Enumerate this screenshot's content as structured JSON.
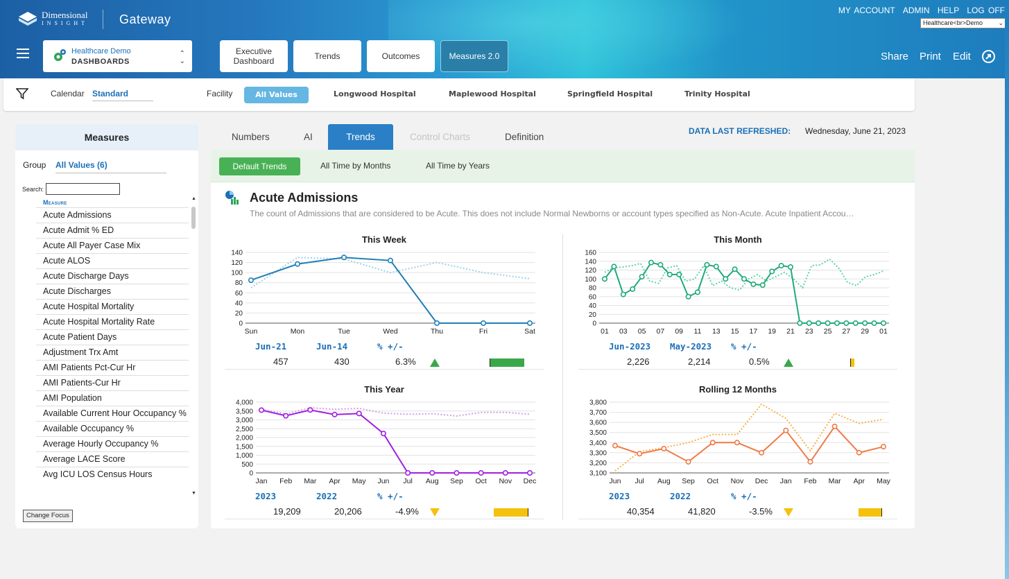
{
  "brand": {
    "name": "Dimensional",
    "sub": "INSIGHT",
    "product": "Gateway"
  },
  "toplinks": [
    "MY ACCOUNT",
    "ADMIN",
    "HELP",
    "LOG OFF"
  ],
  "demo_select": "Healthcare<br>Demo",
  "dashboard_select": {
    "line1": "Healthcare Demo",
    "line2": "DASHBOARDS"
  },
  "nav": [
    {
      "label": "Executive Dashboard"
    },
    {
      "label": "Trends"
    },
    {
      "label": "Outcomes"
    },
    {
      "label": "Measures 2.0"
    }
  ],
  "actions": {
    "share": "Share",
    "print": "Print",
    "edit": "Edit"
  },
  "filters": {
    "calendar_label": "Calendar",
    "calendar_value": "Standard",
    "facility_label": "Facility",
    "facilities": [
      "All Values",
      "Longwood Hospital",
      "Maplewood Hospital",
      "Springfield Hospital",
      "Trinity Hospital"
    ]
  },
  "sidebar": {
    "title": "Measures",
    "group_label": "Group",
    "group_value": "All Values (6)",
    "search_label": "Search:",
    "column_header": "Measure",
    "items": [
      "Acute Admissions",
      "Acute Admit % ED",
      "Acute All Payer Case Mix",
      "Acute ALOS",
      "Acute Discharge Days",
      "Acute Discharges",
      "Acute Hospital Mortality",
      "Acute Hospital Mortality Rate",
      "Acute Patient Days",
      "Adjustment Trx Amt",
      "AMI Patients Pct-Cur Hr",
      "AMI Patients-Cur Hr",
      "AMI Population",
      "Available Current Hour Occupancy %",
      "Available Occupancy %",
      "Average Hourly Occupancy %",
      "Average LACE Score",
      "Avg ICU LOS Census Hours"
    ],
    "change_focus": "Change Focus"
  },
  "tabs": [
    "Numbers",
    "AI",
    "Trends",
    "Control Charts",
    "Definition"
  ],
  "refreshed": {
    "label": "DATA LAST REFRESHED:",
    "value": "Wednesday, June 21, 2023"
  },
  "subtabs": [
    "Default Trends",
    "All Time by Months",
    "All Time by Years"
  ],
  "measure": {
    "title": "Acute Admissions",
    "description": "The count of Admissions that are considered to be Acute. This does not include Normal Newborns or account types specified as Non-Acute. Acute Inpatient Accou…"
  },
  "chart_data": [
    {
      "type": "line",
      "title": "This Week",
      "categories": [
        "Sun",
        "Mon",
        "Tue",
        "Wed",
        "Thu",
        "Fri",
        "Sat"
      ],
      "ylim": [
        0,
        140
      ],
      "yticks": [
        0,
        20,
        40,
        60,
        80,
        100,
        120,
        140
      ],
      "series": [
        {
          "values": [
            85,
            117,
            130,
            124,
            0,
            0,
            0
          ]
        },
        {
          "values": [
            70,
            130,
            127,
            100,
            120,
            100,
            88
          ]
        }
      ],
      "colors": {
        "main": "#1f7fb5",
        "prior": "#9fd0ee"
      },
      "stats": {
        "col1_header": "Jun-21",
        "col2_header": "Jun-14",
        "col3_header": "% +/-",
        "col1_value": "457",
        "col2_value": "430",
        "col3_value": "6.3%",
        "direction": "up",
        "bar_fraction": 0.9,
        "bar_color": "#3aa84a"
      }
    },
    {
      "type": "line",
      "title": "This Month",
      "categories": [
        "01",
        "03",
        "05",
        "07",
        "09",
        "11",
        "13",
        "15",
        "17",
        "19",
        "21",
        "23",
        "25",
        "27",
        "29",
        "01"
      ],
      "ylim": [
        0,
        160
      ],
      "yticks": [
        0,
        20,
        40,
        60,
        80,
        100,
        120,
        140,
        160
      ],
      "series": [
        {
          "values": [
            100,
            128,
            65,
            77,
            105,
            137,
            132,
            110,
            110,
            60,
            70,
            132,
            128,
            100,
            122,
            100,
            88,
            86,
            117,
            130,
            127,
            0,
            0,
            0,
            0,
            0,
            0,
            0,
            0,
            0,
            0
          ]
        },
        {
          "values": [
            115,
            125,
            127,
            130,
            135,
            95,
            90,
            125,
            130,
            95,
            100,
            130,
            85,
            95,
            80,
            75,
            100,
            110,
            95,
            105,
            115,
            100,
            80,
            130,
            132,
            145,
            125,
            92,
            85,
            105,
            110,
            118
          ]
        }
      ],
      "colors": {
        "main": "#1faa78",
        "prior": "#5dd3a6"
      },
      "stats": {
        "col1_header": "Jun-2023",
        "col2_header": "May-2023",
        "col3_header": "% +/-",
        "col1_value": "2,226",
        "col2_value": "2,214",
        "col3_value": "0.5%",
        "direction": "up",
        "bar_fraction": 0.1,
        "bar_color": "#f4c20d"
      }
    },
    {
      "type": "line",
      "title": "This Year",
      "categories": [
        "Jan",
        "Feb",
        "Mar",
        "Apr",
        "May",
        "Jun",
        "Jul",
        "Aug",
        "Sep",
        "Oct",
        "Nov",
        "Dec"
      ],
      "ylim": [
        0,
        4000
      ],
      "yticks": [
        0,
        500,
        1000,
        1500,
        2000,
        2500,
        3000,
        3500,
        4000
      ],
      "series": [
        {
          "values": [
            3550,
            3230,
            3560,
            3300,
            3360,
            2230,
            0,
            0,
            0,
            0,
            0,
            0
          ]
        },
        {
          "values": [
            3600,
            3330,
            3680,
            3600,
            3650,
            3380,
            3320,
            3350,
            3220,
            3420,
            3420,
            3320
          ]
        }
      ],
      "colors": {
        "main": "#a01fe0",
        "prior": "#d79ae8"
      },
      "stats": {
        "col1_header": "2023",
        "col2_header": "2022",
        "col3_header": "% +/-",
        "col1_value": "19,209",
        "col2_value": "20,206",
        "col3_value": "-4.9%",
        "direction": "down",
        "bar_fraction": 0.9,
        "bar_color": "#f4c20d"
      }
    },
    {
      "type": "line",
      "title": "Rolling 12 Months",
      "categories": [
        "Jun",
        "Jul",
        "Aug",
        "Sep",
        "Oct",
        "Nov",
        "Dec",
        "Jan",
        "Feb",
        "Mar",
        "Apr",
        "May"
      ],
      "ylim": [
        3100,
        3800
      ],
      "yticks": [
        3100,
        3200,
        3300,
        3400,
        3500,
        3600,
        3700,
        3800
      ],
      "series": [
        {
          "values": [
            3370,
            3290,
            3340,
            3210,
            3400,
            3400,
            3300,
            3520,
            3210,
            3560,
            3300,
            3360
          ]
        },
        {
          "values": [
            3120,
            3310,
            3350,
            3400,
            3480,
            3480,
            3780,
            3640,
            3320,
            3690,
            3590,
            3630
          ]
        }
      ],
      "colors": {
        "main": "#f07a45",
        "prior": "#f8b04a"
      },
      "stats": {
        "col1_header": "2023",
        "col2_header": "2022",
        "col3_header": "% +/-",
        "col1_value": "40,354",
        "col2_value": "41,820",
        "col3_value": "-3.5%",
        "direction": "down",
        "bar_fraction": 0.6,
        "bar_color": "#f4c20d"
      }
    }
  ]
}
